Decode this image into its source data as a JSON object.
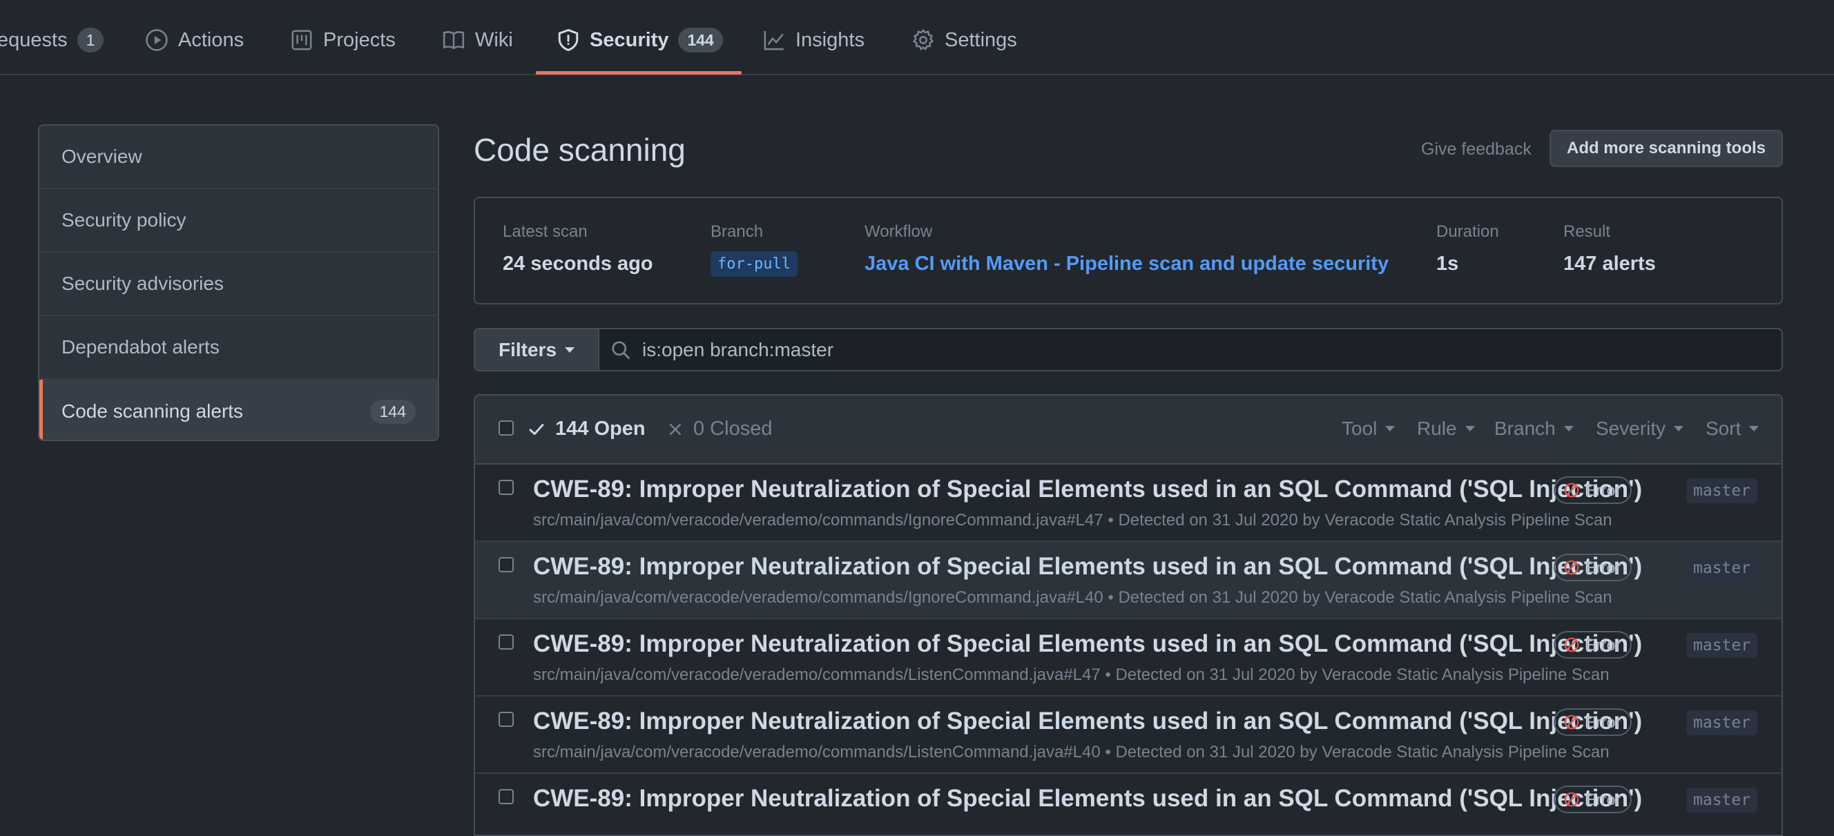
{
  "nav": {
    "tabs": [
      {
        "label": "equests",
        "count": "1",
        "icon": "pull-request-icon"
      },
      {
        "label": "Actions",
        "icon": "play-icon"
      },
      {
        "label": "Projects",
        "icon": "project-icon"
      },
      {
        "label": "Wiki",
        "icon": "book-icon"
      },
      {
        "label": "Security",
        "count": "144",
        "icon": "shield-icon",
        "active": true
      },
      {
        "label": "Insights",
        "icon": "graph-icon"
      },
      {
        "label": "Settings",
        "icon": "gear-icon"
      }
    ]
  },
  "sidebar": {
    "items": [
      {
        "label": "Overview"
      },
      {
        "label": "Security policy"
      },
      {
        "label": "Security advisories"
      },
      {
        "label": "Dependabot alerts"
      },
      {
        "label": "Code scanning alerts",
        "count": "144",
        "selected": true
      }
    ]
  },
  "header": {
    "title": "Code scanning",
    "feedback": "Give feedback",
    "add_tools": "Add more scanning tools"
  },
  "scan": {
    "latest_label": "Latest scan",
    "latest_value": "24 seconds ago",
    "branch_label": "Branch",
    "branch_value": "for-pull",
    "workflow_label": "Workflow",
    "workflow_value": "Java CI with Maven - Pipeline scan and update security",
    "duration_label": "Duration",
    "duration_value": "1s",
    "result_label": "Result",
    "result_value": "147 alerts"
  },
  "filters": {
    "button": "Filters",
    "query": "is:open branch:master"
  },
  "list": {
    "open": "144 Open",
    "closed": "0 Closed",
    "filters": [
      "Tool",
      "Rule",
      "Branch",
      "Severity",
      "Sort"
    ],
    "alerts": [
      {
        "title": "CWE-89: Improper Neutralization of Special Elements used in an SQL Command ('SQL Injection')",
        "path": "src/main/java/com/veracode/verademo/commands/IgnoreCommand.java#L47",
        "detected": "• Detected on 31 Jul 2020 by Veracode Static Analysis Pipeline Scan",
        "severity": "Error",
        "branch": "master"
      },
      {
        "title": "CWE-89: Improper Neutralization of Special Elements used in an SQL Command ('SQL Injection')",
        "path": "src/main/java/com/veracode/verademo/commands/IgnoreCommand.java#L40",
        "detected": "• Detected on 31 Jul 2020 by Veracode Static Analysis Pipeline Scan",
        "severity": "Error",
        "branch": "master"
      },
      {
        "title": "CWE-89: Improper Neutralization of Special Elements used in an SQL Command ('SQL Injection')",
        "path": "src/main/java/com/veracode/verademo/commands/ListenCommand.java#L47",
        "detected": "• Detected on 31 Jul 2020 by Veracode Static Analysis Pipeline Scan",
        "severity": "Error",
        "branch": "master"
      },
      {
        "title": "CWE-89: Improper Neutralization of Special Elements used in an SQL Command ('SQL Injection')",
        "path": "src/main/java/com/veracode/verademo/commands/ListenCommand.java#L40",
        "detected": "• Detected on 31 Jul 2020 by Veracode Static Analysis Pipeline Scan",
        "severity": "Error",
        "branch": "master"
      },
      {
        "title": "CWE-89: Improper Neutralization of Special Elements used in an SQL Command ('SQL Injection')",
        "path": "",
        "detected": "",
        "severity": "Error",
        "branch": "master"
      }
    ]
  },
  "colors": {
    "background": "#22272e",
    "accent_underline": "#ec775c",
    "link": "#539bf5",
    "error_icon": "#e5534b"
  }
}
